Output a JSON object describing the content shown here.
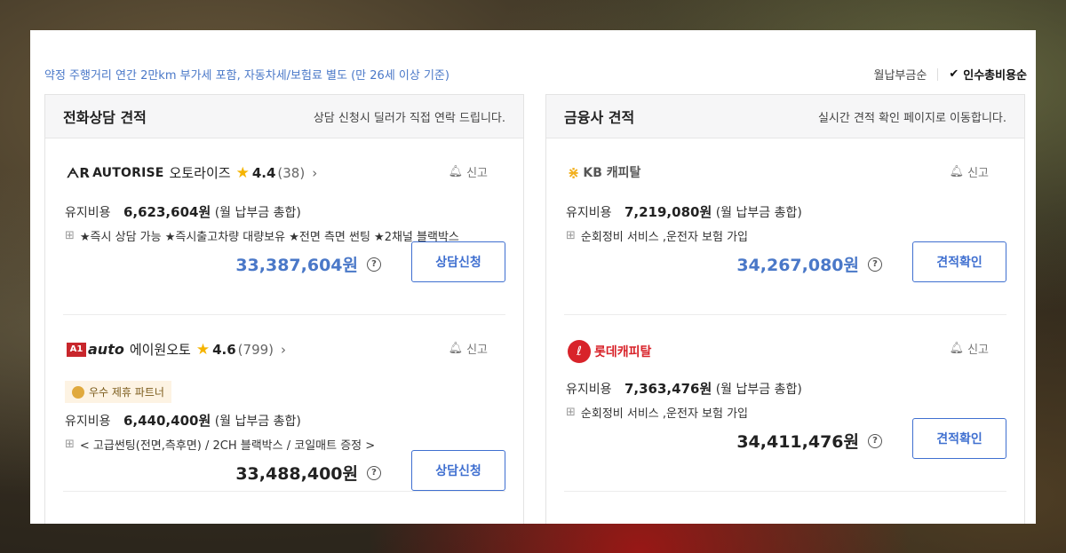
{
  "header": {
    "note": "약정 주행거리 연간 2만km 부가세 포함, 자동차세/보험료 별도 (만 26세 이상 기준)",
    "sort_monthly": "월납부금순",
    "sort_total": "인수총비용순",
    "check_glyph": "✔"
  },
  "left": {
    "title": "전화상담 견적",
    "subtitle": "상담 신청시 딜러가 직접 연락 드립니다.",
    "items": [
      {
        "logo_mark": "ᗅR",
        "logo_text": "AUTORISE",
        "name": "오토라이즈",
        "star": "★",
        "rating": "4.4",
        "count": "(38)",
        "chevron": "›",
        "report": "신고",
        "fee_label": "유지비용",
        "fee_value": "6,623,604원",
        "fee_suffix": "(월 납부금 총합)",
        "options": "★즉시 상담 가능 ★즉시출고차량 대량보유 ★전면 측면 썬팅 ★2채널 블랙박스",
        "price": "33,387,604원",
        "price_color": "#4a78c8",
        "button": "상담신청"
      },
      {
        "logo_box": "A1",
        "logo_text": "auto",
        "name": "에이원오토",
        "star": "★",
        "rating": "4.6",
        "count": "(799)",
        "chevron": "›",
        "report": "신고",
        "partner_badge": "우수 제휴 파트너",
        "fee_label": "유지비용",
        "fee_value": "6,440,400원",
        "fee_suffix": "(월 납부금 총합)",
        "options": "< 고급썬팅(전면,측후면) / 2CH 블랙박스 / 코일매트 증정 >",
        "price": "33,488,400원",
        "price_color": "#222222",
        "button": "상담신청"
      }
    ]
  },
  "right": {
    "title": "금융사 견적",
    "subtitle": "실시간 견적 확인 페이지로 이동합니다.",
    "items": [
      {
        "logo_mark": "⋇",
        "logo_text": "KB 캐피탈",
        "report": "신고",
        "fee_label": "유지비용",
        "fee_value": "7,219,080원",
        "fee_suffix": "(월 납부금 총합)",
        "options": "순회정비 서비스 ,운전자 보험 가입",
        "price": "34,267,080원",
        "price_color": "#4a78c8",
        "button": "견적확인"
      },
      {
        "logo_mark": "ℓ",
        "logo_text": "롯데캐피탈",
        "report": "신고",
        "fee_label": "유지비용",
        "fee_value": "7,363,476원",
        "fee_suffix": "(월 납부금 총합)",
        "options": "순회정비 서비스 ,운전자 보험 가입",
        "price": "34,411,476원",
        "price_color": "#222222",
        "button": "견적확인"
      }
    ]
  },
  "icons": {
    "bell": "🔔︎",
    "gift": "⊞",
    "help": "?"
  }
}
